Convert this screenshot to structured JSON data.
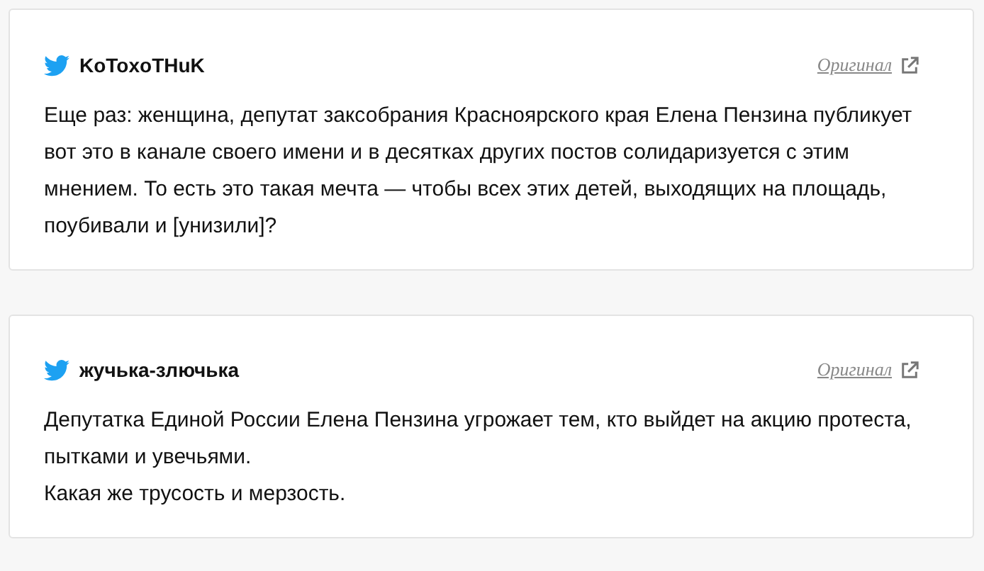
{
  "posts": [
    {
      "author": "KoToxoTHuK",
      "link": "Оригинал",
      "paragraphs": [
        "Еще раз: женщина, депутат заксобрания Красноярского края Елена Пензина публикует вот это в канале своего имени и в десятках других постов солидаризуется с этим мнением. То есть это такая мечта — чтобы всех этих детей, выходящих на площадь, поубивали и [унизили]?"
      ]
    },
    {
      "author": "жучька-злючька",
      "link": "Оригинал",
      "paragraphs": [
        "Депутатка Единой России Елена Пензина угрожает тем, кто выйдет на акцию протеста, пытками и увечьями.",
        "Какая же трусость и мерзость."
      ]
    }
  ]
}
